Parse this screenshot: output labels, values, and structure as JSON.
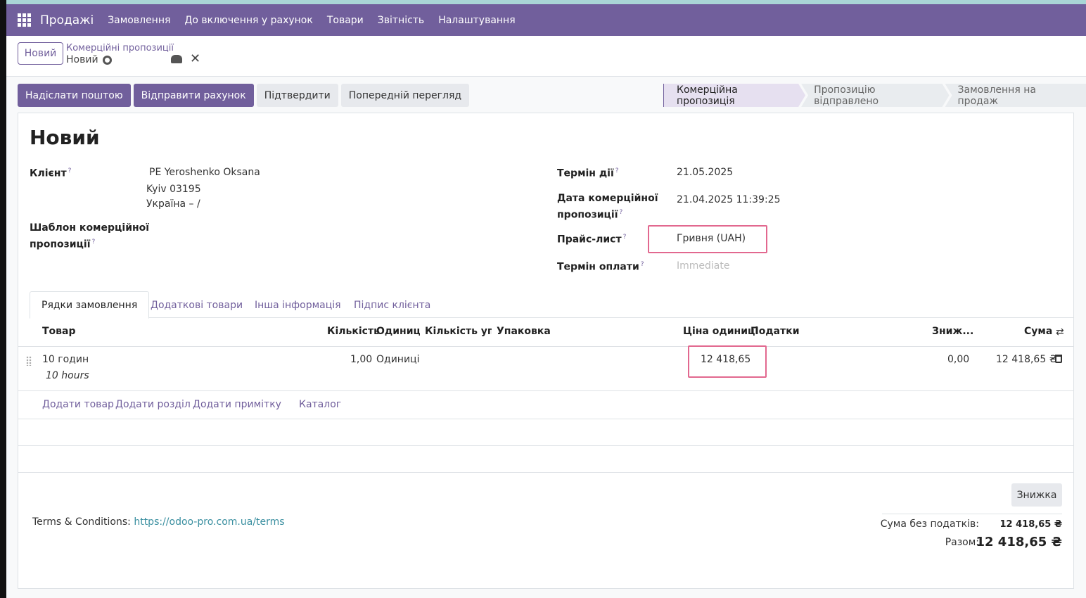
{
  "navbar": {
    "brand": "Продажі",
    "items": [
      "Замовлення",
      "До включення у рахунок",
      "Товари",
      "Звітність",
      "Налаштування"
    ]
  },
  "control": {
    "new_button": "Новий",
    "breadcrumb_parent": "Комерційні пропозиції",
    "breadcrumb_current": "Новий"
  },
  "actions": {
    "send_email": "Надіслати поштою",
    "send_invoice": "Відправити рахунок",
    "confirm": "Підтвердити",
    "preview": "Попередній перегляд"
  },
  "stages": [
    "Комерційна пропозиція",
    "Пропозицію відправлено",
    "Замовлення на продаж"
  ],
  "form": {
    "title": "Новий",
    "customer_label": "Клієнт",
    "customer_name": "PE Yeroshenko Oksana",
    "customer_city": "Kyiv 03195",
    "customer_country": "Україна – /",
    "template_label_1": "Шаблон комерційної",
    "template_label_2": "пропозиції",
    "validity_label": "Термін дії",
    "validity_value": "21.05.2025",
    "quote_date_label_1": "Дата комерційної",
    "quote_date_label_2": "пропозиції",
    "quote_date_value": "21.04.2025 11:39:25",
    "pricelist_label": "Прайс-лист",
    "pricelist_value": "Гривня (UAH)",
    "payment_label": "Термін оплати",
    "payment_placeholder": "Immediate",
    "help_mark": "?"
  },
  "tabs": [
    "Рядки замовлення",
    "Додаткові товари",
    "Інша інформація",
    "Підпис клієнта"
  ],
  "table": {
    "headers": {
      "product": "Товар",
      "qty": "Кількість",
      "uom": "Одиниці...",
      "pkg_qty": "Кількість уп...",
      "packaging": "Упаковка",
      "price": "Ціна одиниці",
      "taxes": "Податки",
      "discount": "Зниж...",
      "amount": "Сума"
    },
    "row": {
      "product": "10 годин",
      "description": "10 hours",
      "qty": "1,00",
      "uom": "Одиниці",
      "price": "12 418,65",
      "discount": "0,00",
      "amount": "12 418,65 ₴"
    },
    "add_product": "Додати товар",
    "add_section": "Додати розділ",
    "add_note": "Додати примітку",
    "catalog": "Каталог"
  },
  "terms": {
    "label": "Terms & Conditions:",
    "link": "https://odoo-pro.com.ua/terms"
  },
  "totals": {
    "discount_button": "Знижка",
    "untaxed_label": "Сума без податків:",
    "untaxed_value": "12 418,65 ₴",
    "total_label": "Разом:",
    "total_value": "12 418,65 ₴"
  }
}
